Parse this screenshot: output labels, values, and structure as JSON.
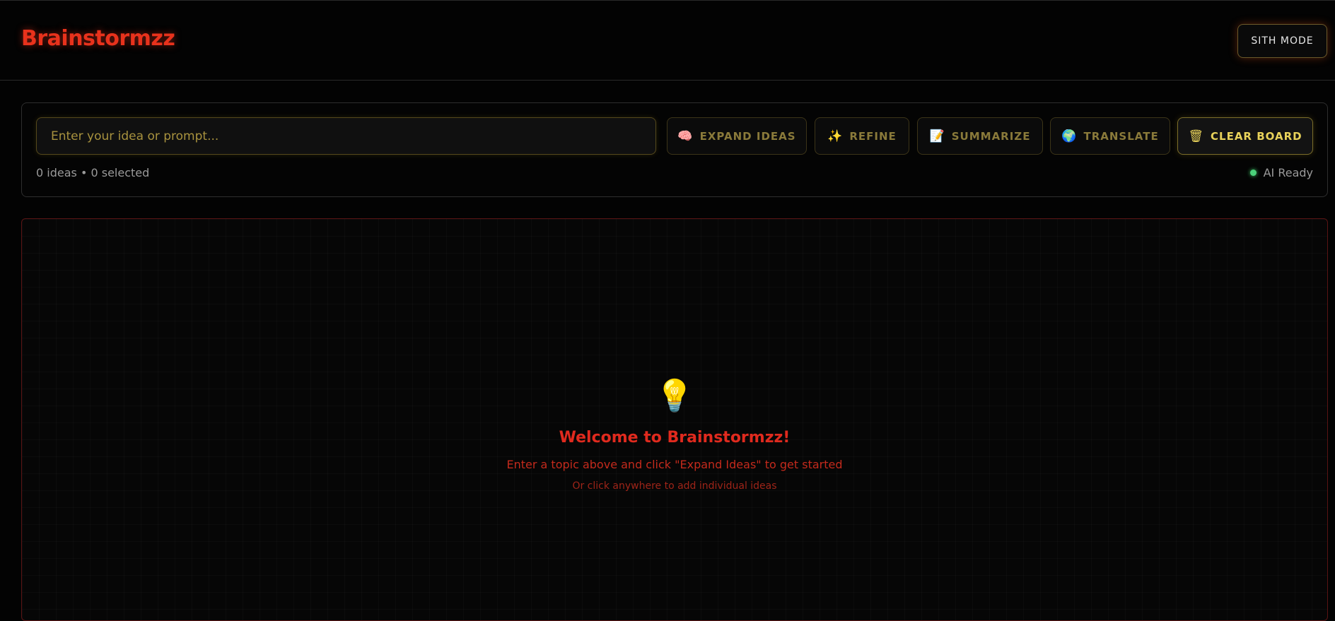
{
  "app": {
    "title": "Brainstormzz",
    "mode_button": "SITH MODE"
  },
  "prompt": {
    "placeholder": "Enter your idea or prompt...",
    "value": ""
  },
  "actions": {
    "expand": {
      "icon": "🧠",
      "label": "EXPAND IDEAS"
    },
    "refine": {
      "icon": "✨",
      "label": "REFINE"
    },
    "summarize": {
      "icon": "📝",
      "label": "SUMMARIZE"
    },
    "translate": {
      "icon": "🌍",
      "label": "TRANSLATE"
    },
    "clear": {
      "icon": "🗑",
      "label": "CLEAR BOARD"
    }
  },
  "status": {
    "counts": "0 ideas • 0 selected",
    "ai": "AI Ready"
  },
  "board": {
    "icon": "💡",
    "title": "Welcome to Brainstormzz!",
    "subtitle": "Enter a topic above and click \"Expand Ideas\" to get started",
    "hint": "Or click anywhere to add individual ideas"
  },
  "colors": {
    "brand": "#e8321c",
    "accent_gold": "#e8d25a",
    "ai_ready": "#4bd17a"
  }
}
